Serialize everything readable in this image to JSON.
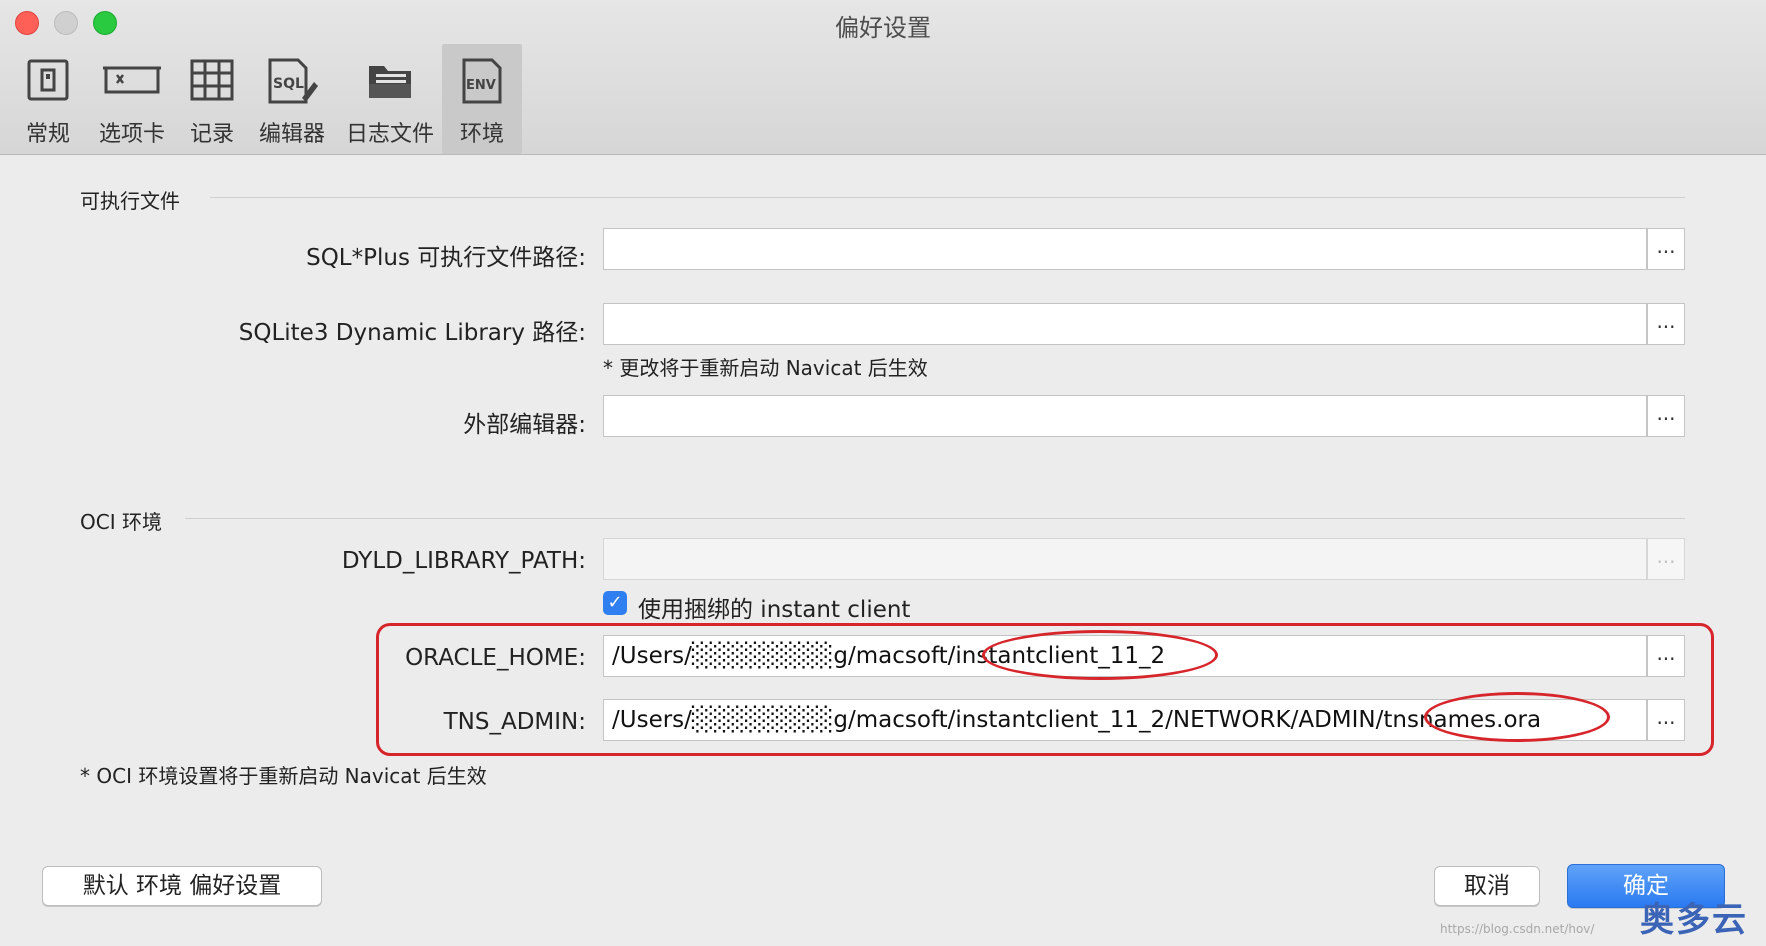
{
  "window": {
    "title": "偏好设置"
  },
  "toolbar": {
    "tabs": [
      {
        "label": "常规",
        "icon": "general-icon"
      },
      {
        "label": "选项卡",
        "icon": "tab-icon"
      },
      {
        "label": "记录",
        "icon": "grid-icon"
      },
      {
        "label": "编辑器",
        "icon": "sql-editor-icon"
      },
      {
        "label": "日志文件",
        "icon": "folder-icon"
      },
      {
        "label": "环境",
        "icon": "env-icon",
        "active": true
      }
    ],
    "sql_icon_text": "SQL",
    "env_icon_text": "ENV"
  },
  "executables": {
    "heading": "可执行文件",
    "sqlplus_label": "SQL*Plus 可执行文件路径:",
    "sqlplus_value": "",
    "sqlite_label": "SQLite3 Dynamic Library 路径:",
    "sqlite_value": "",
    "restart_note": "* 更改将于重新启动 Navicat 后生效",
    "external_editor_label": "外部编辑器:",
    "external_editor_value": ""
  },
  "oci": {
    "heading": "OCI 环境",
    "dyld_label": "DYLD_LIBRARY_PATH:",
    "dyld_value": "",
    "use_bundled_label": "使用捆绑的 instant client",
    "use_bundled_checked": true,
    "oracle_home_label": "ORACLE_HOME:",
    "oracle_home_value": "/Users/░░░░░░░░g/macsoft/instantclient_11_2",
    "tns_admin_label": "TNS_ADMIN:",
    "tns_admin_value": "/Users/░░░░░░░░g/macsoft/instantclient_11_2/NETWORK/ADMIN/tnsnames.ora",
    "restart_note": "* OCI 环境设置将于重新启动 Navicat 后生效"
  },
  "browse_label": "...",
  "check_mark": "✓",
  "buttons": {
    "reset": "默认 环境 偏好设置",
    "cancel": "取消",
    "ok": "确定"
  },
  "watermark": {
    "text": "奥多云",
    "url": "https://blog.csdn.net/hov/"
  },
  "colors": {
    "accent": "#2f7ff0",
    "annotation": "#d7262b"
  }
}
